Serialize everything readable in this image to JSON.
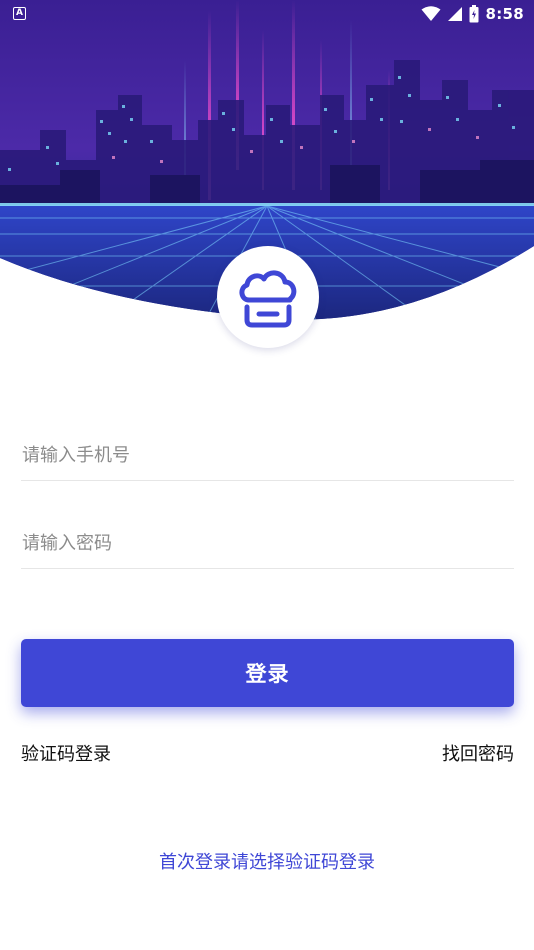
{
  "status_bar": {
    "time": "8:58",
    "left_icon": "app-notification-icon",
    "icons": [
      "wifi-icon",
      "signal-icon",
      "battery-icon"
    ]
  },
  "header": {
    "background": "cyberpunk-city-night",
    "logo_icon": "cloud-printer-logo-icon"
  },
  "form": {
    "phone_placeholder": "请输入手机号",
    "password_placeholder": "请输入密码"
  },
  "actions": {
    "login_label": "登录",
    "code_login_label": "验证码登录",
    "forgot_password_label": "找回密码",
    "first_login_tip": "首次登录请选择验证码登录"
  },
  "colors": {
    "accent": "#3f47d6",
    "text": "#111111",
    "placeholder": "#8c8c8c",
    "divider": "#e6e6e6"
  }
}
